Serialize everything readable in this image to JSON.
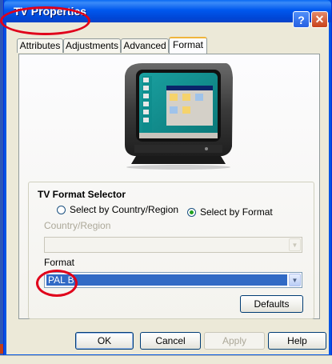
{
  "window": {
    "title": "TV Properties"
  },
  "titlebar": {
    "help_glyph": "?",
    "close_glyph": "✕"
  },
  "tabs": [
    {
      "label": "Attributes"
    },
    {
      "label": "Adjustments"
    },
    {
      "label": "Advanced"
    },
    {
      "label": "Format"
    }
  ],
  "format_selector": {
    "title": "TV Format Selector",
    "radio_country": "Select by Country/Region",
    "radio_format": "Select by Format",
    "selected": "Select by Format",
    "country_label": "Country/Region",
    "country_value": "",
    "format_label": "Format",
    "format_value": "PAL B",
    "defaults_button": "Defaults"
  },
  "buttons": {
    "ok": "OK",
    "cancel": "Cancel",
    "apply": "Apply",
    "help": "Help"
  },
  "icons": {
    "tv": "crt-television-icon",
    "arrow": "chevron-down-icon"
  },
  "colors": {
    "titlebar": "#0058ee",
    "highlight": "#316ac5",
    "annotation": "#e0001a",
    "tab_accent": "#f0b53c"
  }
}
